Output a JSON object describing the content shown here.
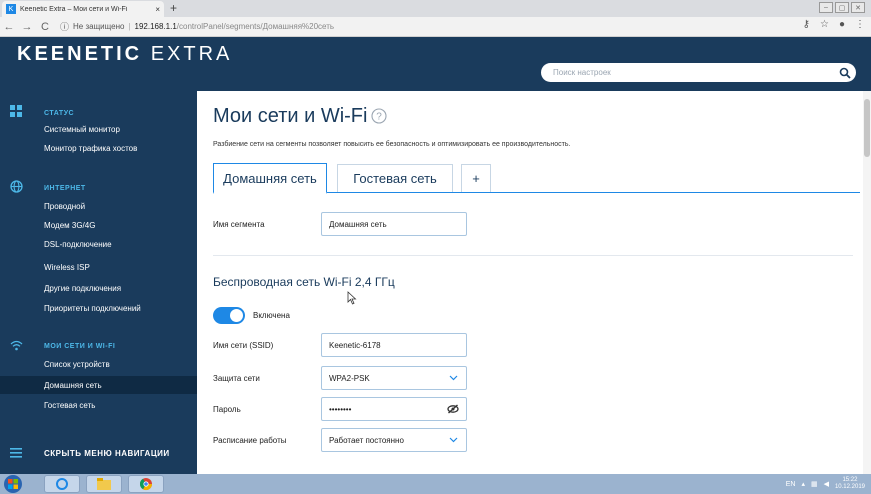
{
  "browser": {
    "tab_title": "Keenetic Extra – Мои сети и Wi-Fi",
    "tab_close": "×",
    "new_tab": "+",
    "url_security": "Не защищено",
    "url_host": "192.168.1.1",
    "url_path": "/controlPanel/segments/Домашняя%20сеть"
  },
  "header": {
    "logo_bold": "KEENETIC",
    "logo_light": "EXTRA",
    "search_placeholder": "Поиск настроек"
  },
  "sidebar": {
    "sections": [
      {
        "title": "СТАТУС",
        "icon": "dashboard-icon",
        "items": [
          "Системный монитор",
          "Монитор трафика хостов"
        ]
      },
      {
        "title": "ИНТЕРНЕТ",
        "icon": "globe-icon",
        "items": [
          "Проводной",
          "Модем 3G/4G",
          "DSL-подключение",
          "Wireless ISP",
          "Другие подключения",
          "Приоритеты подключений"
        ]
      },
      {
        "title": "МОИ СЕТИ И WI-FI",
        "icon": "wifi-icon",
        "items": [
          "Список устройств",
          "Домашняя сеть",
          "Гостевая сеть"
        ]
      }
    ],
    "active_item": "Домашняя сеть",
    "hide_nav": "СКРЫТЬ МЕНЮ НАВИГАЦИИ"
  },
  "main": {
    "title": "Мои сети и Wi-Fi",
    "description": "Разбиение сети на сегменты позволяет повысить ее безопасность и оптимизировать ее производительность.",
    "tabs": [
      "Домашняя сеть",
      "Гостевая сеть",
      "+"
    ],
    "segment_name_label": "Имя сегмента",
    "segment_name_value": "Домашняя сеть",
    "wireless_title": "Беспроводная сеть Wi-Fi 2,4 ГГц",
    "toggle_label": "Включена",
    "toggle_on": true,
    "ssid_label": "Имя сети (SSID)",
    "ssid_value": "Keenetic-6178",
    "security_label": "Защита сети",
    "security_value": "WPA2-PSK",
    "password_label": "Пароль",
    "password_value": "••••••••",
    "schedule_label": "Расписание работы",
    "schedule_value": "Работает постоянно"
  },
  "taskbar": {
    "lang": "EN",
    "time": "15:22",
    "date": "10.12.2019"
  },
  "colors": {
    "nav_bg": "#1a3b5c",
    "accent": "#1e88e5",
    "section_title": "#4db8e8"
  }
}
